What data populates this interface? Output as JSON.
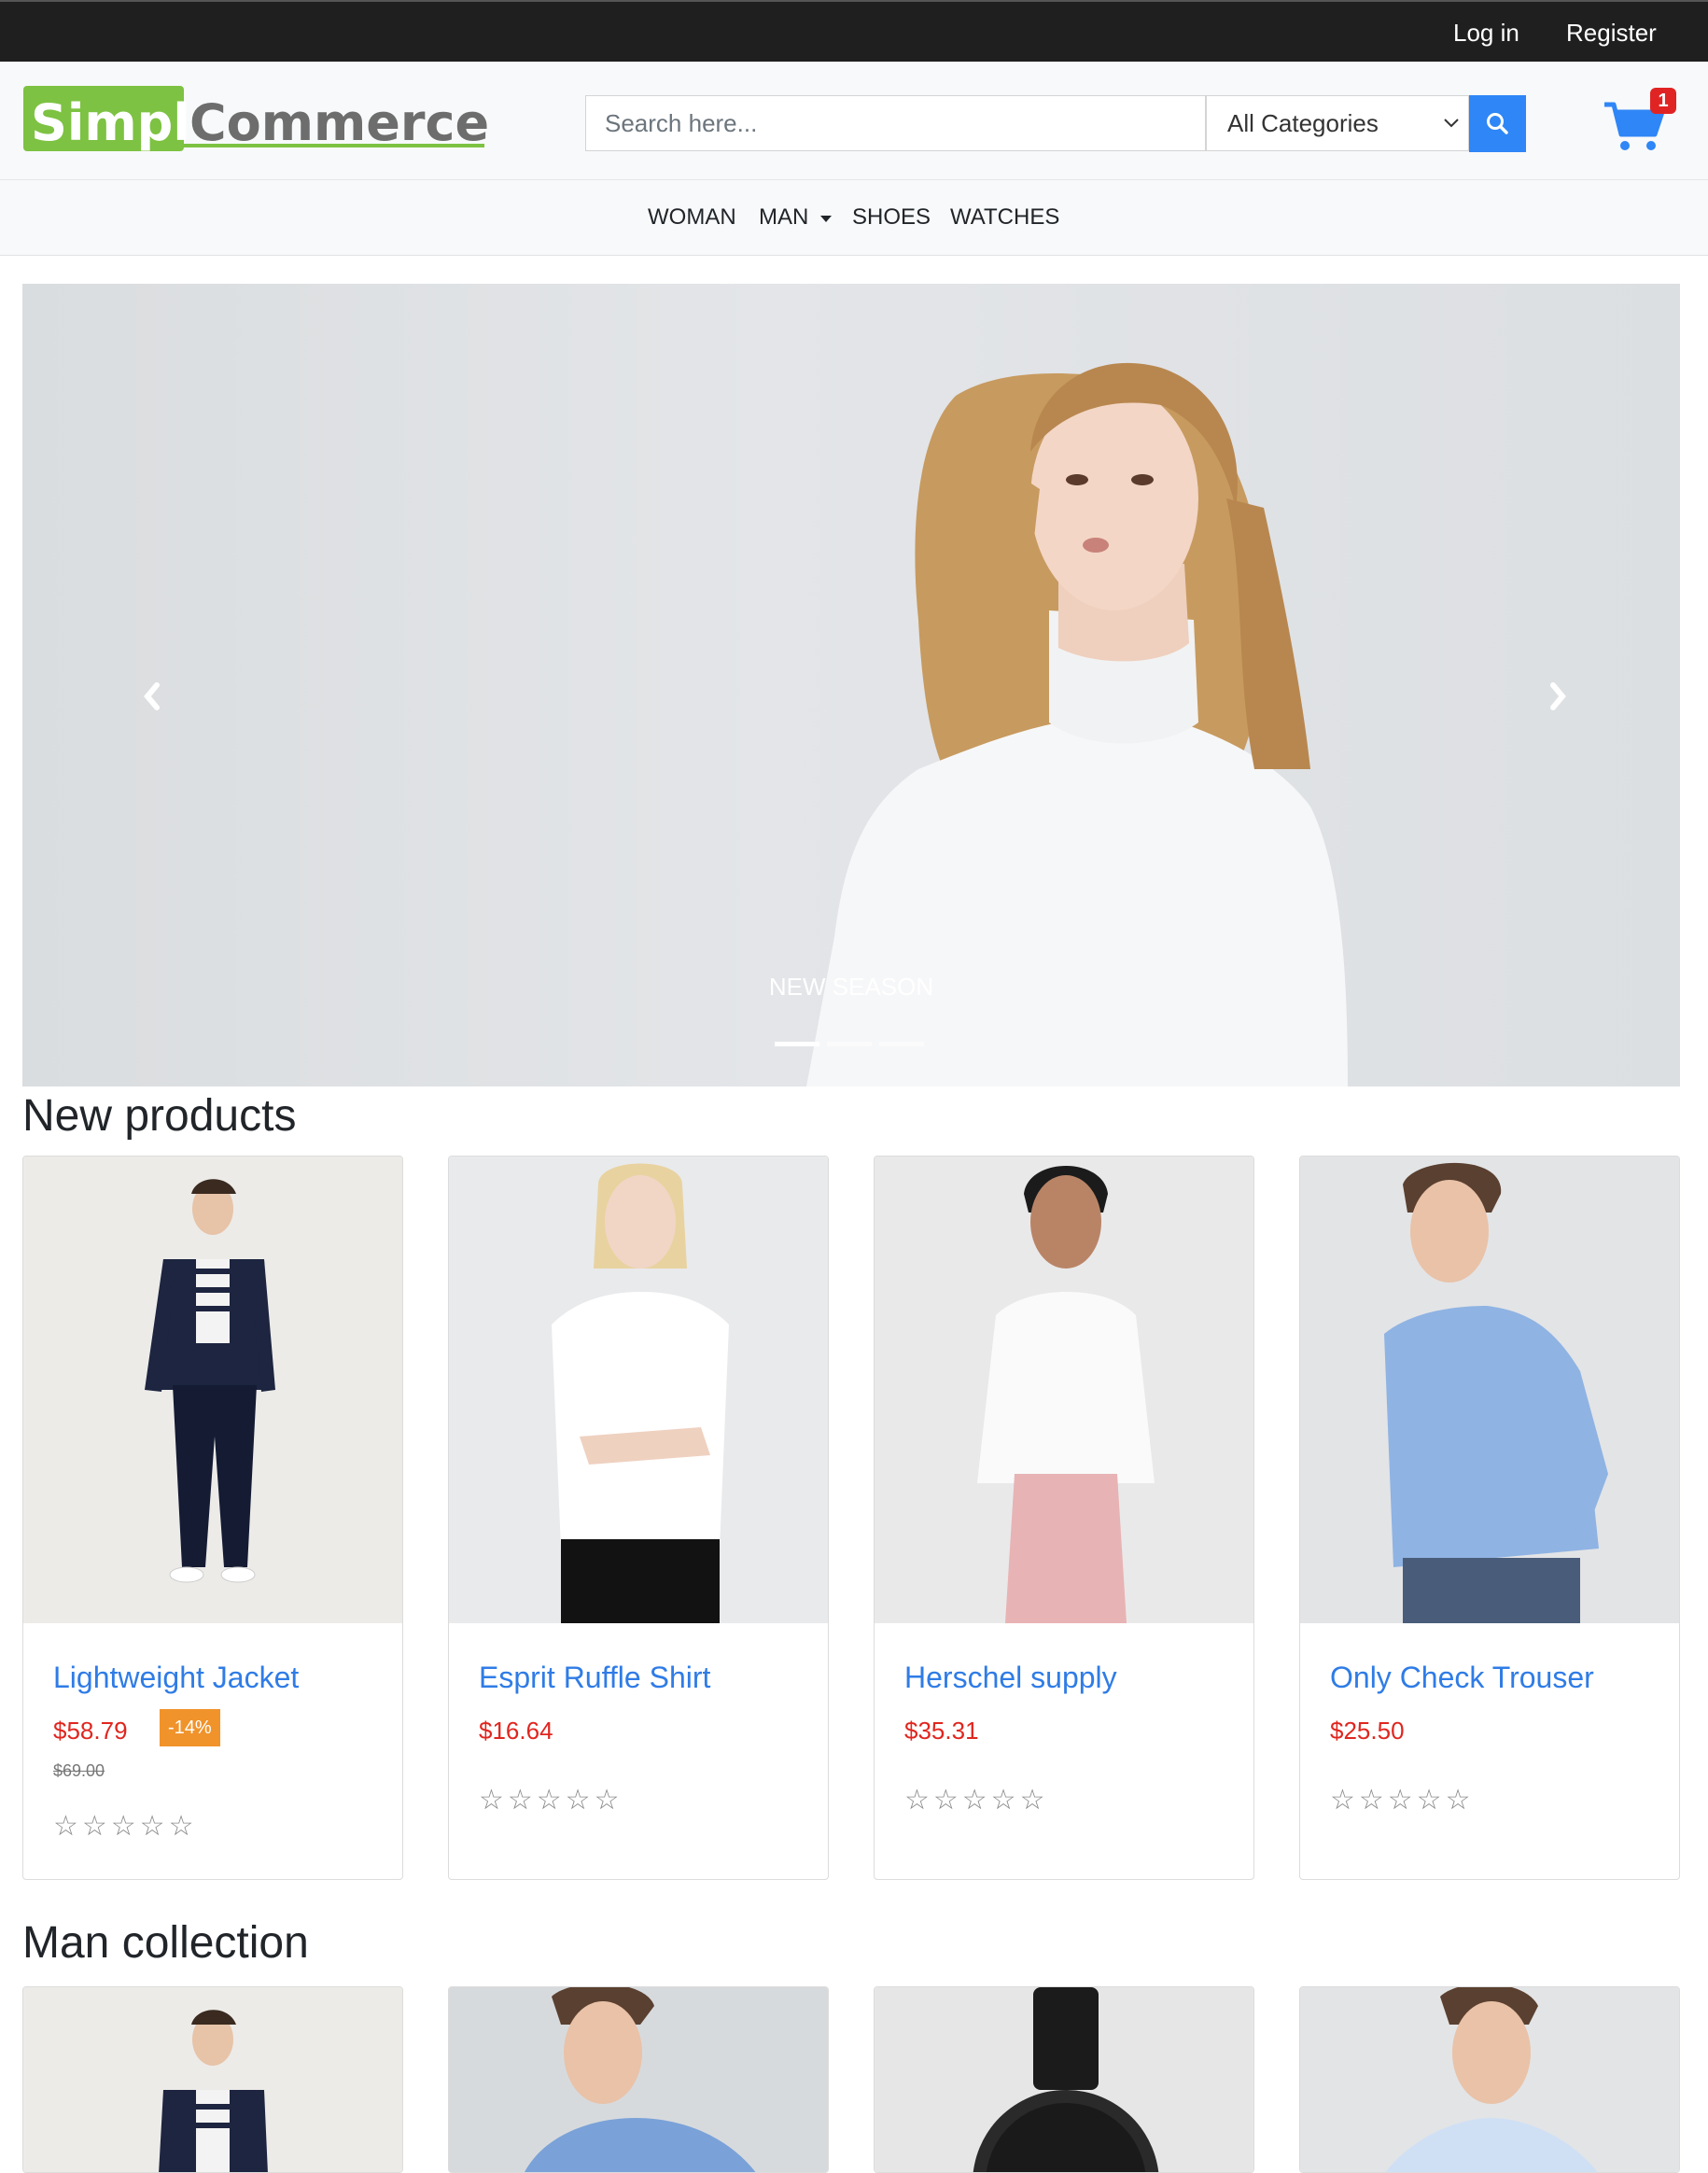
{
  "topbar": {
    "login": "Log in",
    "register": "Register"
  },
  "header": {
    "logo_part1": "Simpl",
    "logo_part2": "Commerce",
    "search_placeholder": "Search here...",
    "category_selected": "All Categories",
    "cart_count": "1",
    "colors": {
      "logo_green": "#7dc242",
      "accent": "#2f86f6",
      "badge": "#e02424"
    }
  },
  "nav": {
    "items": [
      {
        "label": "WOMAN"
      },
      {
        "label": "MAN",
        "has_dropdown": true
      },
      {
        "label": "SHOES"
      },
      {
        "label": "WATCHES"
      }
    ]
  },
  "hero": {
    "caption": "NEW SEASON",
    "slide_count": 3,
    "active_slide": 1
  },
  "sections": {
    "new_products": {
      "title": "New products",
      "products": [
        {
          "name": "Lightweight Jacket",
          "price": "$58.79",
          "discount": "-14%",
          "old_price": "$69.00",
          "rating": 0
        },
        {
          "name": "Esprit Ruffle Shirt",
          "price": "$16.64",
          "rating": 0
        },
        {
          "name": "Herschel supply",
          "price": "$35.31",
          "rating": 0
        },
        {
          "name": "Only Check Trouser",
          "price": "$25.50",
          "rating": 0
        }
      ]
    },
    "man_collection": {
      "title": "Man collection"
    }
  },
  "stars_text": "☆☆☆☆☆"
}
